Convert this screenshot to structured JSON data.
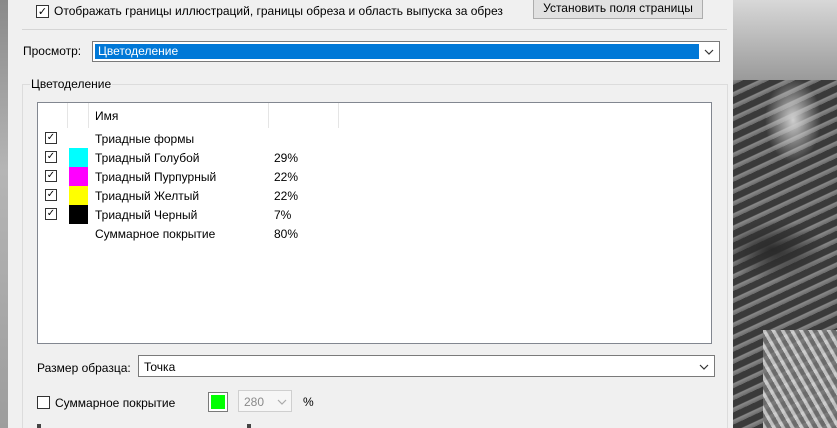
{
  "options": {
    "show_bounds_label": "Отображать границы иллюстраций, границы обреза и область выпуска за обрез",
    "show_bounds_checked": true,
    "page_setup_button": "Установить поля страницы"
  },
  "view": {
    "label": "Просмотр:",
    "selected": "Цветоделение"
  },
  "separations": {
    "group_label": "Цветоделение",
    "column_name": "Имя",
    "rows": [
      {
        "checked": true,
        "swatch": "",
        "name": "Триадные формы",
        "percent": ""
      },
      {
        "checked": true,
        "swatch": "#00ffff",
        "name": "Триадный Голубой",
        "percent": "29%"
      },
      {
        "checked": true,
        "swatch": "#ff00ff",
        "name": "Триадный Пурпурный",
        "percent": "22%"
      },
      {
        "checked": true,
        "swatch": "#ffff00",
        "name": "Триадный Желтый",
        "percent": "22%"
      },
      {
        "checked": true,
        "swatch": "#000000",
        "name": "Триадный Черный",
        "percent": "7%"
      },
      {
        "checked": false,
        "swatch": "",
        "name": "Суммарное покрытие",
        "percent": "80%"
      }
    ]
  },
  "sample": {
    "label": "Размер образца:",
    "selected": "Точка"
  },
  "coverage": {
    "label": "Суммарное покрытие",
    "checked": false,
    "color": "#00ff00",
    "value": "280",
    "unit": "%"
  },
  "icons": {
    "checkmark": "check-icon",
    "dropdown": "chevron-down-icon"
  }
}
